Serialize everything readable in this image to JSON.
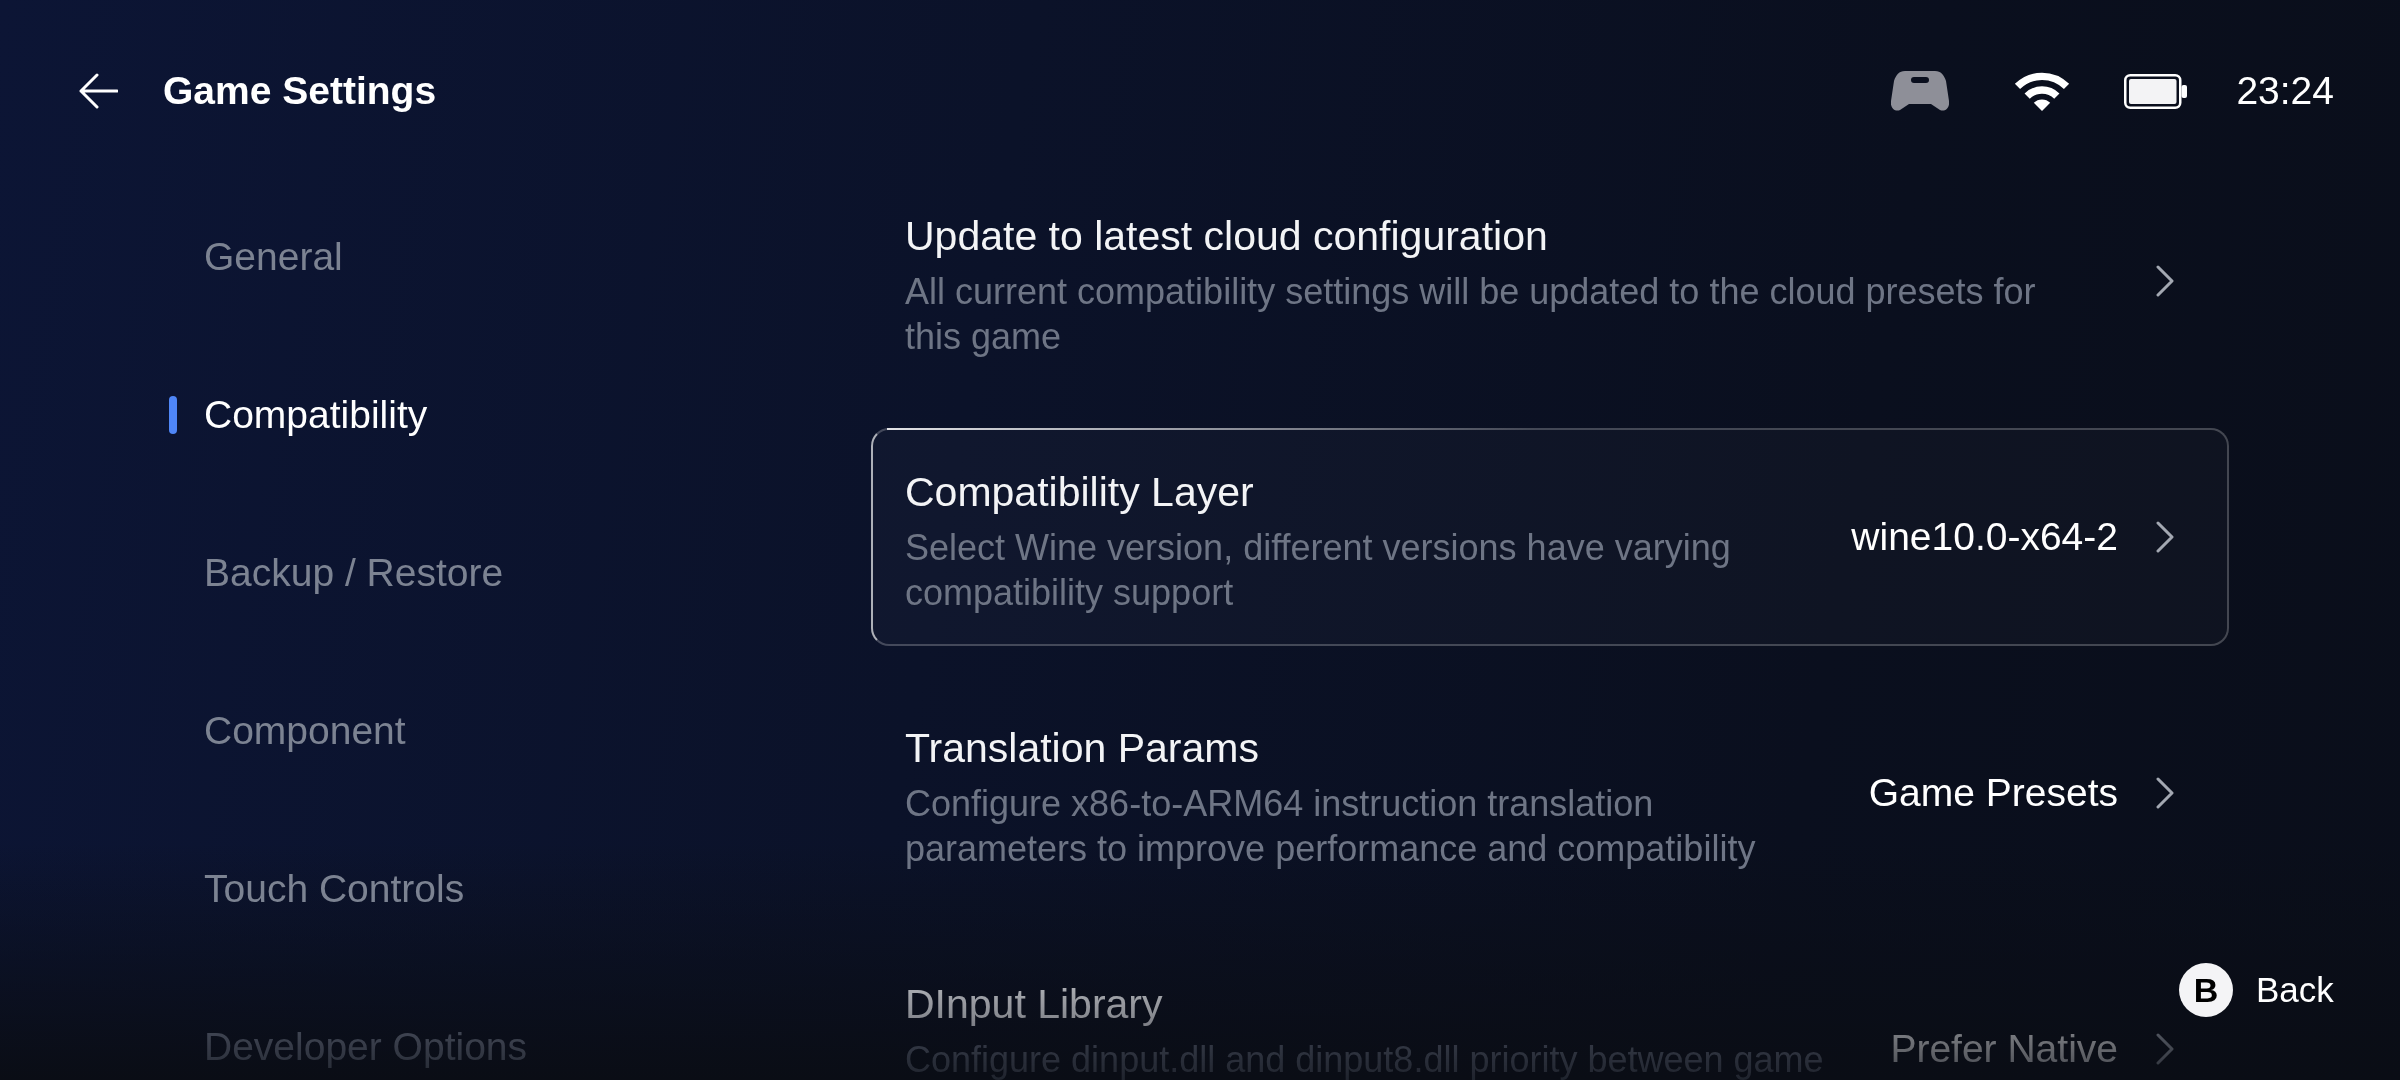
{
  "header": {
    "title": "Game Settings"
  },
  "status_bar": {
    "time": "23:24"
  },
  "sidebar": {
    "items": [
      {
        "label": "General",
        "selected": false
      },
      {
        "label": "Compatibility",
        "selected": true
      },
      {
        "label": "Backup / Restore",
        "selected": false
      },
      {
        "label": "Component",
        "selected": false
      },
      {
        "label": "Touch Controls",
        "selected": false
      },
      {
        "label": "Developer Options",
        "selected": false
      }
    ]
  },
  "settings": [
    {
      "title": "Update to latest cloud configuration",
      "description": "All current compatibility settings will be updated to the cloud presets for this game",
      "focused": false
    },
    {
      "title": "Compatibility Layer",
      "description": "Select Wine version, different versions have varying compatibility support",
      "value": "wine10.0-x64-2",
      "focused": true
    },
    {
      "title": "Translation Params",
      "description": "Configure x86-to-ARM64 instruction translation parameters to improve performance and compatibility",
      "value": "Game Presets",
      "focused": false
    },
    {
      "title": "DInput Library",
      "description": "Configure dinput.dll and dinput8.dll priority between game",
      "value": "Prefer Native",
      "focused": false
    }
  ],
  "hint": {
    "key": "B",
    "label": "Back"
  }
}
